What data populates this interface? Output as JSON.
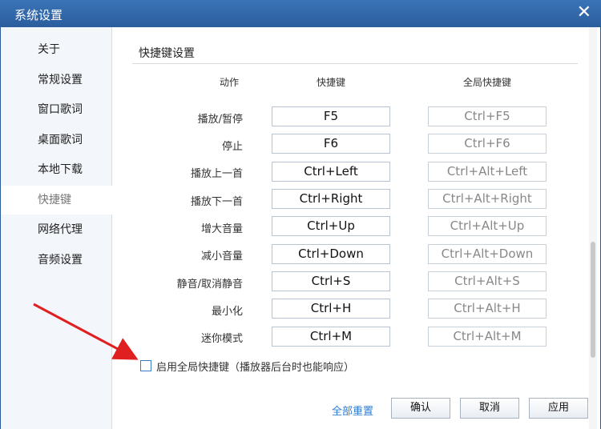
{
  "window": {
    "title": "系统设置",
    "close_glyph": "✕"
  },
  "sidebar": {
    "items": [
      {
        "label": "关于"
      },
      {
        "label": "常规设置"
      },
      {
        "label": "窗口歌词"
      },
      {
        "label": "桌面歌词"
      },
      {
        "label": "本地下载"
      },
      {
        "label": "快捷键",
        "active": true
      },
      {
        "label": "网络代理"
      },
      {
        "label": "音频设置"
      }
    ]
  },
  "hotkeys": {
    "section_title": "快捷键设置",
    "columns": {
      "action": "动作",
      "hotkey": "快捷键",
      "global": "全局快捷键"
    },
    "rows": [
      {
        "action": "播放/暂停",
        "hotkey": "F5",
        "global": "Ctrl+F5"
      },
      {
        "action": "停止",
        "hotkey": "F6",
        "global": "Ctrl+F6"
      },
      {
        "action": "播放上一首",
        "hotkey": "Ctrl+Left",
        "global": "Ctrl+Alt+Left"
      },
      {
        "action": "播放下一首",
        "hotkey": "Ctrl+Right",
        "global": "Ctrl+Alt+Right"
      },
      {
        "action": "增大音量",
        "hotkey": "Ctrl+Up",
        "global": "Ctrl+Alt+Up"
      },
      {
        "action": "减小音量",
        "hotkey": "Ctrl+Down",
        "global": "Ctrl+Alt+Down"
      },
      {
        "action": "静音/取消静音",
        "hotkey": "Ctrl+S",
        "global": "Ctrl+Alt+S"
      },
      {
        "action": "最小化",
        "hotkey": "Ctrl+H",
        "global": "Ctrl+Alt+H"
      },
      {
        "action": "迷你模式",
        "hotkey": "Ctrl+M",
        "global": "Ctrl+Alt+M"
      }
    ],
    "enable_global_label": "启用全局快捷键（播放器后台时也能响应）",
    "enable_global_checked": false
  },
  "footer": {
    "reset_all": "全部重置",
    "confirm": "确认",
    "cancel": "取消",
    "apply": "应用"
  },
  "colors": {
    "titlebar": "#2a5d9c",
    "accent": "#2b7cd3",
    "arrow": "#e02020"
  }
}
